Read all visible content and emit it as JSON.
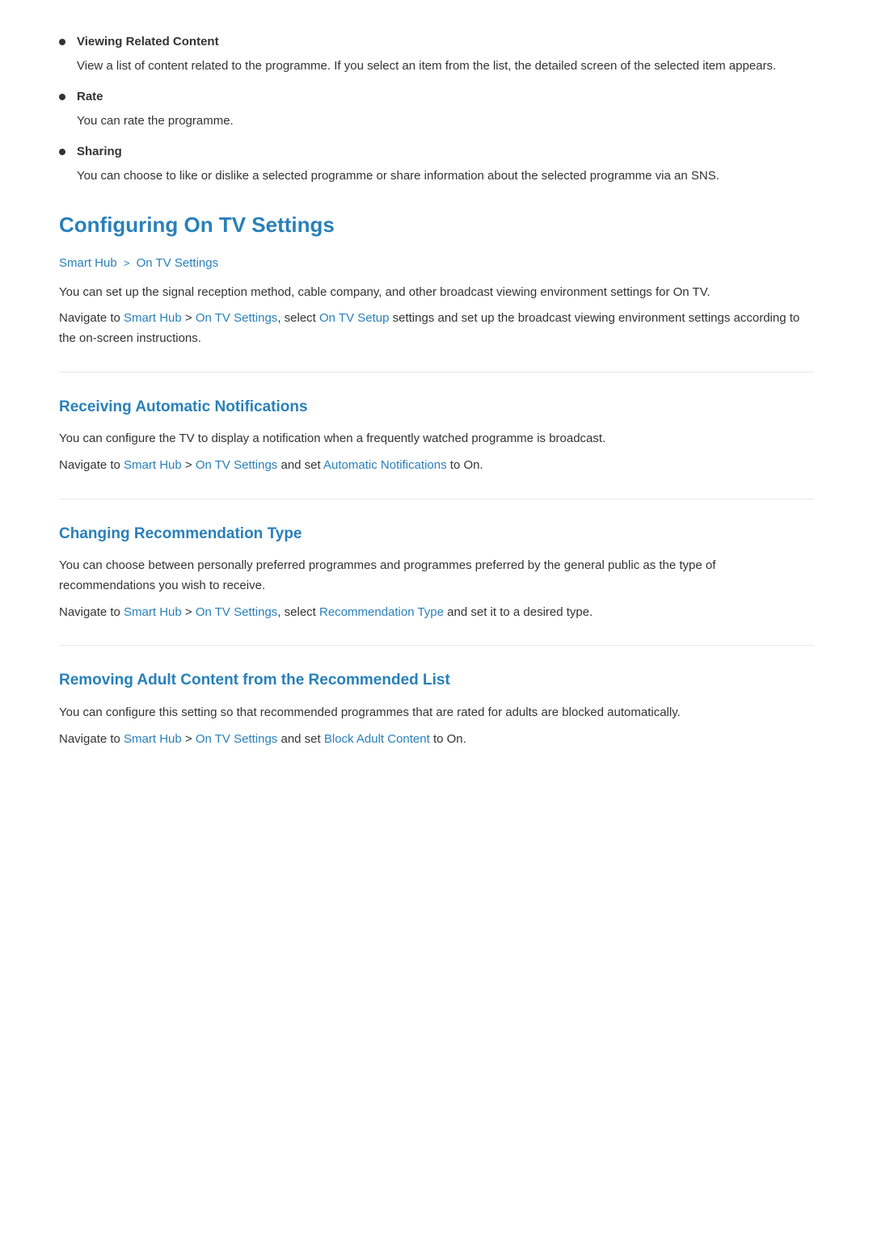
{
  "page": {
    "bullets": [
      {
        "id": "viewing-related",
        "title": "Viewing Related Content",
        "description": "View a list of content related to the programme. If you select an item from the list, the detailed screen of the selected item appears."
      },
      {
        "id": "rate",
        "title": "Rate",
        "description": "You can rate the programme."
      },
      {
        "id": "sharing",
        "title": "Sharing",
        "description": "You can choose to like or dislike a selected programme or share information about the selected programme via an SNS."
      }
    ],
    "configuring": {
      "heading": "Configuring On TV Settings",
      "breadcrumb": {
        "part1": "Smart Hub",
        "sep": ">",
        "part2": "On TV Settings"
      },
      "intro1": "You can set up the signal reception method, cable company, and other broadcast viewing environment settings for On TV.",
      "intro2_prefix": "Navigate to ",
      "intro2_link1": "Smart Hub",
      "intro2_sep": ">",
      "intro2_link2": "On TV Settings",
      "intro2_mid": ", select ",
      "intro2_link3": "On TV Setup",
      "intro2_suffix": " settings and set up the broadcast viewing environment settings according to the on-screen instructions."
    },
    "receiving": {
      "heading": "Receiving Automatic Notifications",
      "body1": "You can configure the TV to display a notification when a frequently watched programme is broadcast.",
      "body2_prefix": "Navigate to ",
      "body2_link1": "Smart Hub",
      "body2_sep": ">",
      "body2_link2": "On TV Settings",
      "body2_mid": " and set ",
      "body2_link3": "Automatic Notifications",
      "body2_suffix": " to On."
    },
    "changing": {
      "heading": "Changing Recommendation Type",
      "body1": "You can choose between personally preferred programmes and programmes preferred by the general public as the type of recommendations you wish to receive.",
      "body2_prefix": "Navigate to ",
      "body2_link1": "Smart Hub",
      "body2_sep": ">",
      "body2_link2": "On TV Settings",
      "body2_mid": ", select ",
      "body2_link3": "Recommendation Type",
      "body2_suffix": " and set it to a desired type."
    },
    "removing": {
      "heading": "Removing Adult Content from the Recommended List",
      "body1": "You can configure this setting so that recommended programmes that are rated for adults are blocked automatically.",
      "body2_prefix": "Navigate to ",
      "body2_link1": "Smart Hub",
      "body2_sep": ">",
      "body2_link2": "On TV Settings",
      "body2_mid": " and set ",
      "body2_link3": "Block Adult Content",
      "body2_suffix": " to On."
    }
  }
}
